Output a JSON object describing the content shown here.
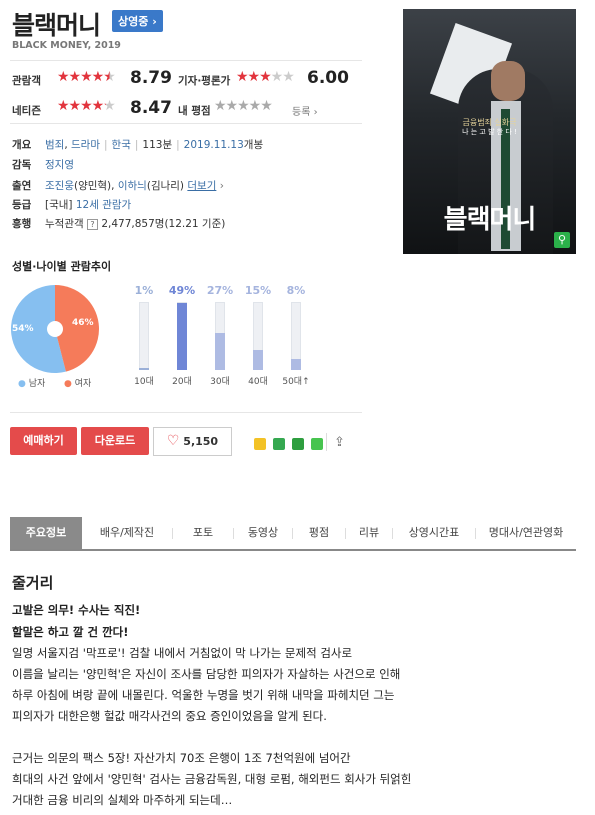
{
  "movie": {
    "title": "블랙머니",
    "status_badge": "상영중",
    "subtitle": "BLACK MONEY, 2019"
  },
  "ratings": {
    "audience": {
      "label": "관람객",
      "score": "8.79"
    },
    "critic": {
      "label": "기자·평론가",
      "score": "6.00"
    },
    "netizen": {
      "label": "네티즌",
      "score": "8.47"
    },
    "mine": {
      "label": "내 평점",
      "register": "등록"
    }
  },
  "info": {
    "overview": {
      "key": "개요",
      "genre1": "범죄",
      "genre2": "드라마",
      "country": "한국",
      "runtime": "113분",
      "release_date": "2019.11.13",
      "release_suffix": "개봉"
    },
    "director": {
      "key": "감독",
      "name": "정지영"
    },
    "cast": {
      "key": "출연",
      "actor1": "조진웅",
      "role1": "(양민혁)",
      "actor2": "이하늬",
      "role2": "(김나리)",
      "more": "더보기"
    },
    "grade": {
      "key": "등급",
      "country": "[국내]",
      "grade": "12세 관람가"
    },
    "boxoffice": {
      "key": "흥행",
      "label": "누적관객",
      "value": "2,477,857명",
      "date": "(12.21 기준)"
    }
  },
  "poster": {
    "tagline": "금융범죄 실화극",
    "quote": "나 는   고 발 한 다 !",
    "title": "블랙머니"
  },
  "trend": {
    "title": "성별·나이별 관람추이",
    "gender": {
      "male_pct": "54%",
      "female_pct": "46%",
      "male_value": 54,
      "female_value": 46,
      "male_label": "남자",
      "female_label": "여자",
      "male_color": "#86bff0",
      "female_color": "#f57b5a"
    },
    "ages": [
      {
        "label": "10대",
        "pct": "1%",
        "value": 1,
        "color": "#9bb0d8",
        "pct_color": "#9bb0d8"
      },
      {
        "label": "20대",
        "pct": "49%",
        "value": 49,
        "color": "#6f86d6",
        "pct_color": "#6f86d6"
      },
      {
        "label": "30대",
        "pct": "27%",
        "value": 27,
        "color": "#aebbe3",
        "pct_color": "#a5b4de"
      },
      {
        "label": "40대",
        "pct": "15%",
        "value": 15,
        "color": "#aebbe3",
        "pct_color": "#a5b4de"
      },
      {
        "label": "50대↑",
        "pct": "8%",
        "value": 8,
        "color": "#aebbe3",
        "pct_color": "#a5b4de"
      }
    ]
  },
  "actions": {
    "reserve": "예매하기",
    "download": "다운로드",
    "like_count": "5,150",
    "share_icons": [
      "blog-icon",
      "cafe-icon",
      "band-icon",
      "line-icon",
      "share-icon"
    ]
  },
  "tabs": [
    "주요정보",
    "배우/제작진",
    "포토",
    "동영상",
    "평점",
    "리뷰",
    "상영시간표",
    "명대사/연관영화"
  ],
  "synopsis": {
    "heading": "줄거리",
    "tagline1": "고발은 의무! 수사는 직진!",
    "tagline2": "할말은 하고 깔 건 깐다!",
    "lines": [
      "일명 서울지검 '막프로'! 검찰 내에서 거침없이 막 나가는 문제적 검사로",
      " 이름을 날리는 '양민혁'은 자신이 조사를 담당한 피의자가 자살하는 사건으로 인해",
      " 하루 아침에 벼랑 끝에 내몰린다. 억울한 누명을 벗기 위해 내막을 파헤치던 그는",
      " 피의자가 대한은행 헐값 매각사건의 중요 증인이었음을 알게 된다.",
      "",
      " 근거는 의문의 팩스 5장! 자산가치 70조 은행이 1조 7천억원에 넘어간",
      " 희대의 사건 앞에서 '양민혁' 검사는 금융감독원, 대형 로펌, 해외펀드 회사가 뒤얽힌",
      " 거대한 금융 비리의 실체와 마주하게 되는데…"
    ]
  }
}
